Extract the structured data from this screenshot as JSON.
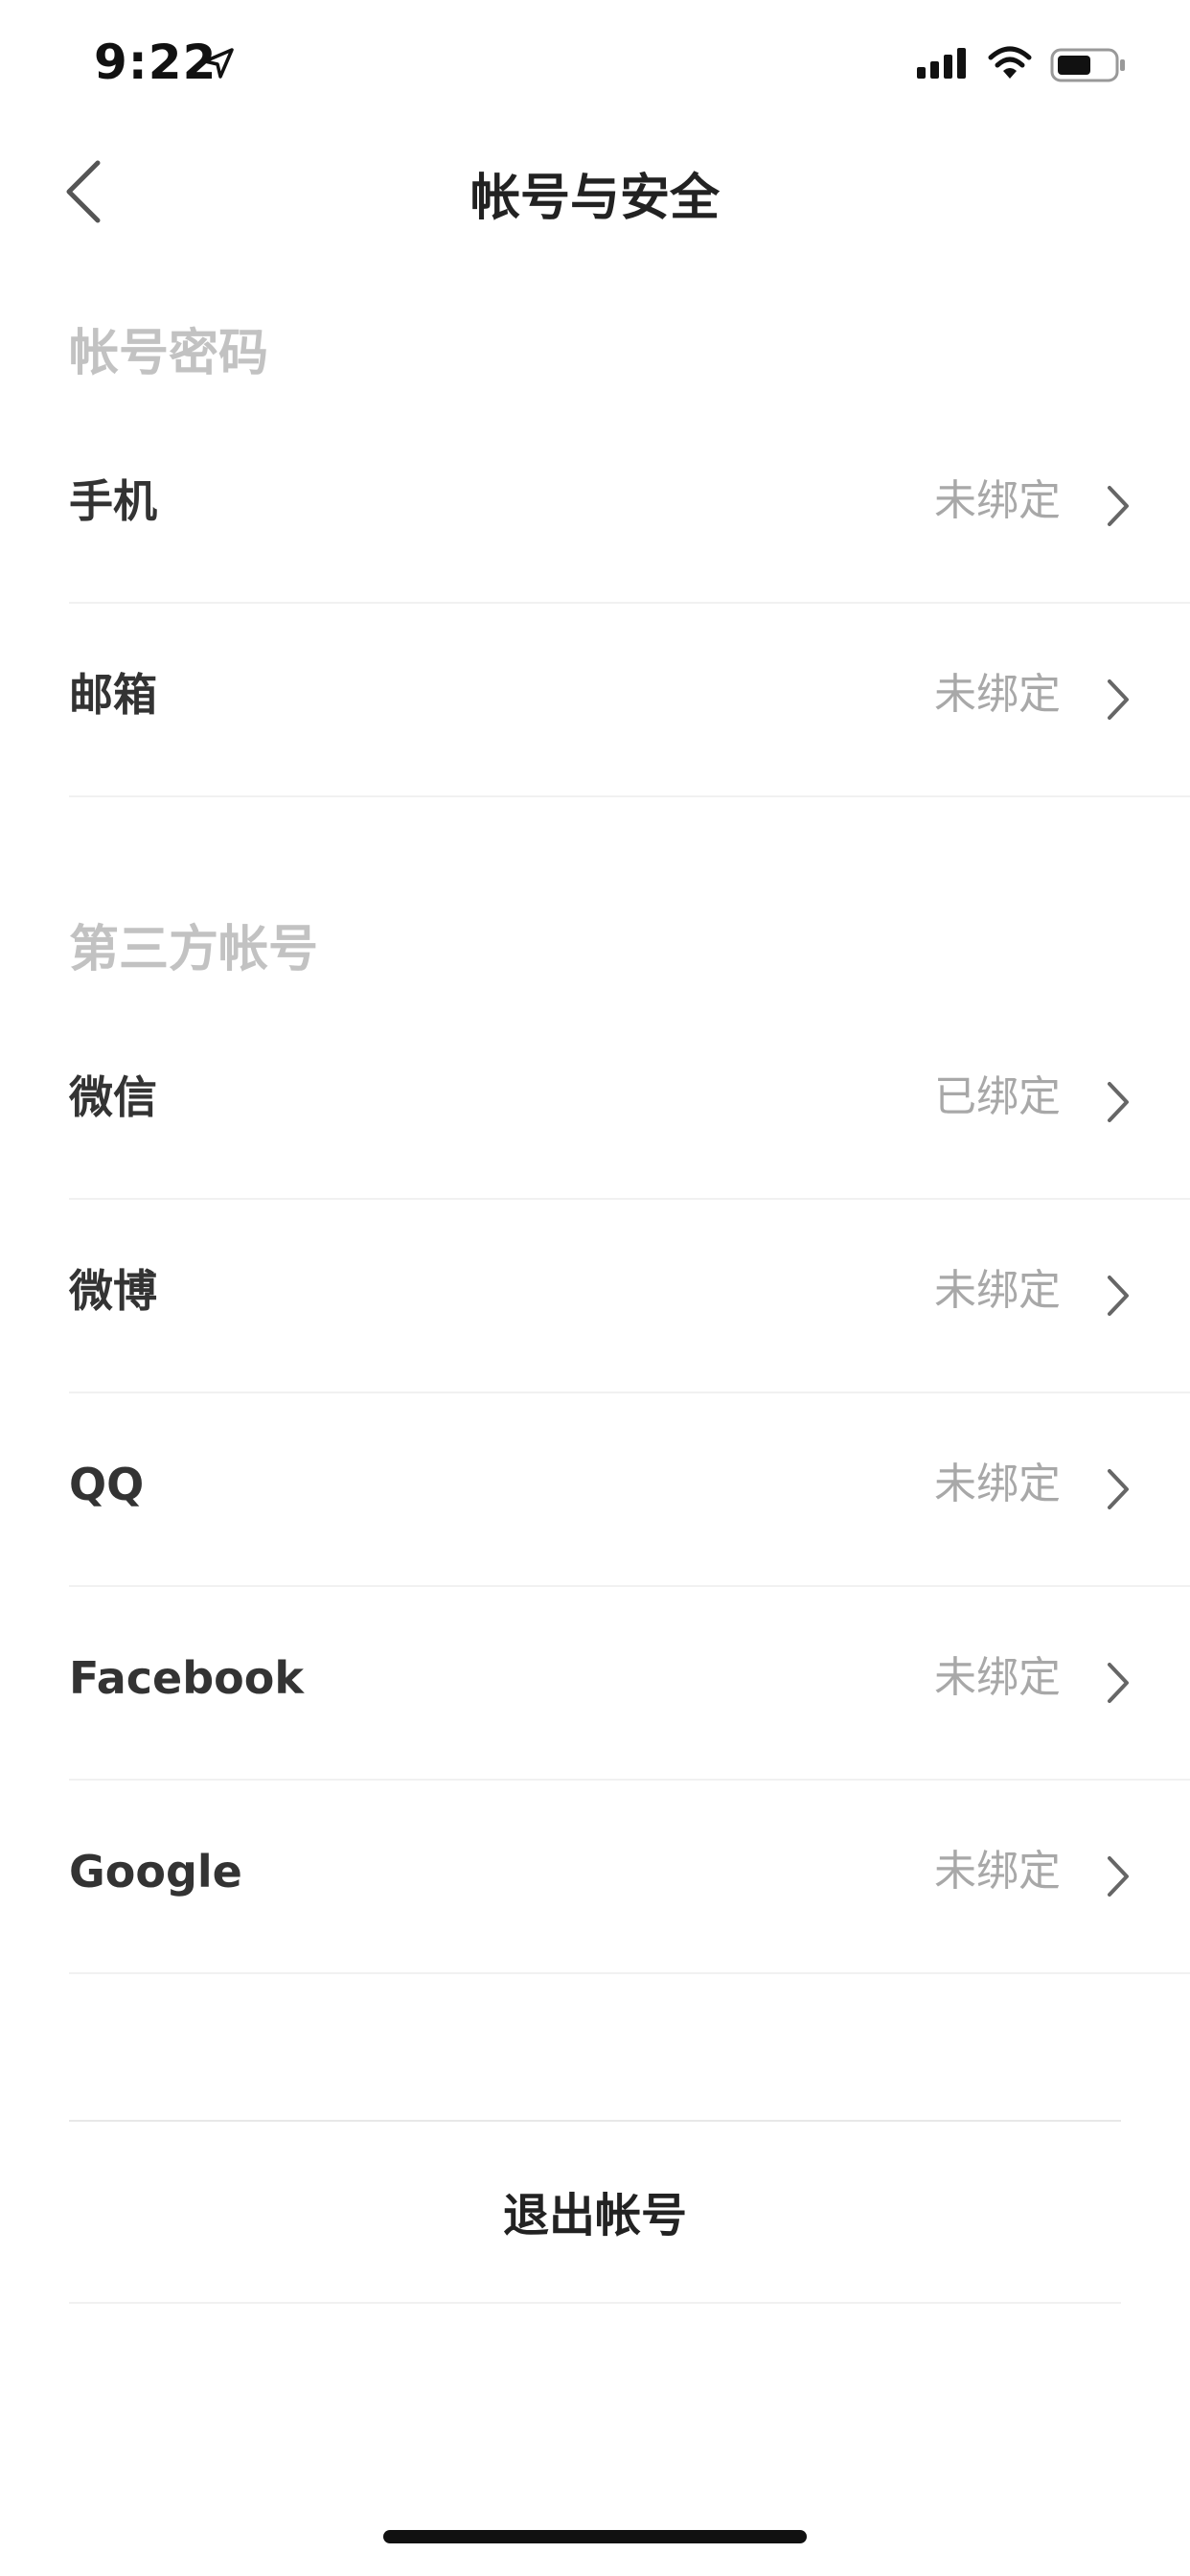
{
  "status_bar": {
    "time": "9:22"
  },
  "nav": {
    "title": "帐号与安全"
  },
  "sections": {
    "account": {
      "header": "帐号密码",
      "rows": [
        {
          "label": "手机",
          "status": "未绑定"
        },
        {
          "label": "邮箱",
          "status": "未绑定"
        }
      ]
    },
    "third_party": {
      "header": "第三方帐号",
      "rows": [
        {
          "label": "微信",
          "status": "已绑定"
        },
        {
          "label": "微博",
          "status": "未绑定"
        },
        {
          "label": "QQ",
          "status": "未绑定"
        },
        {
          "label": "Facebook",
          "status": "未绑定"
        },
        {
          "label": "Google",
          "status": "未绑定"
        }
      ]
    }
  },
  "logout": {
    "label": "退出帐号"
  },
  "colors": {
    "header_text": "#c2c2c2",
    "label_text": "#333333",
    "status_text": "#a8a8a8",
    "divider": "#f1f1f1"
  },
  "icons": [
    "location-arrow-icon",
    "signal-icon",
    "wifi-icon",
    "battery-icon",
    "back-arrow-icon",
    "chevron-right-icon"
  ]
}
